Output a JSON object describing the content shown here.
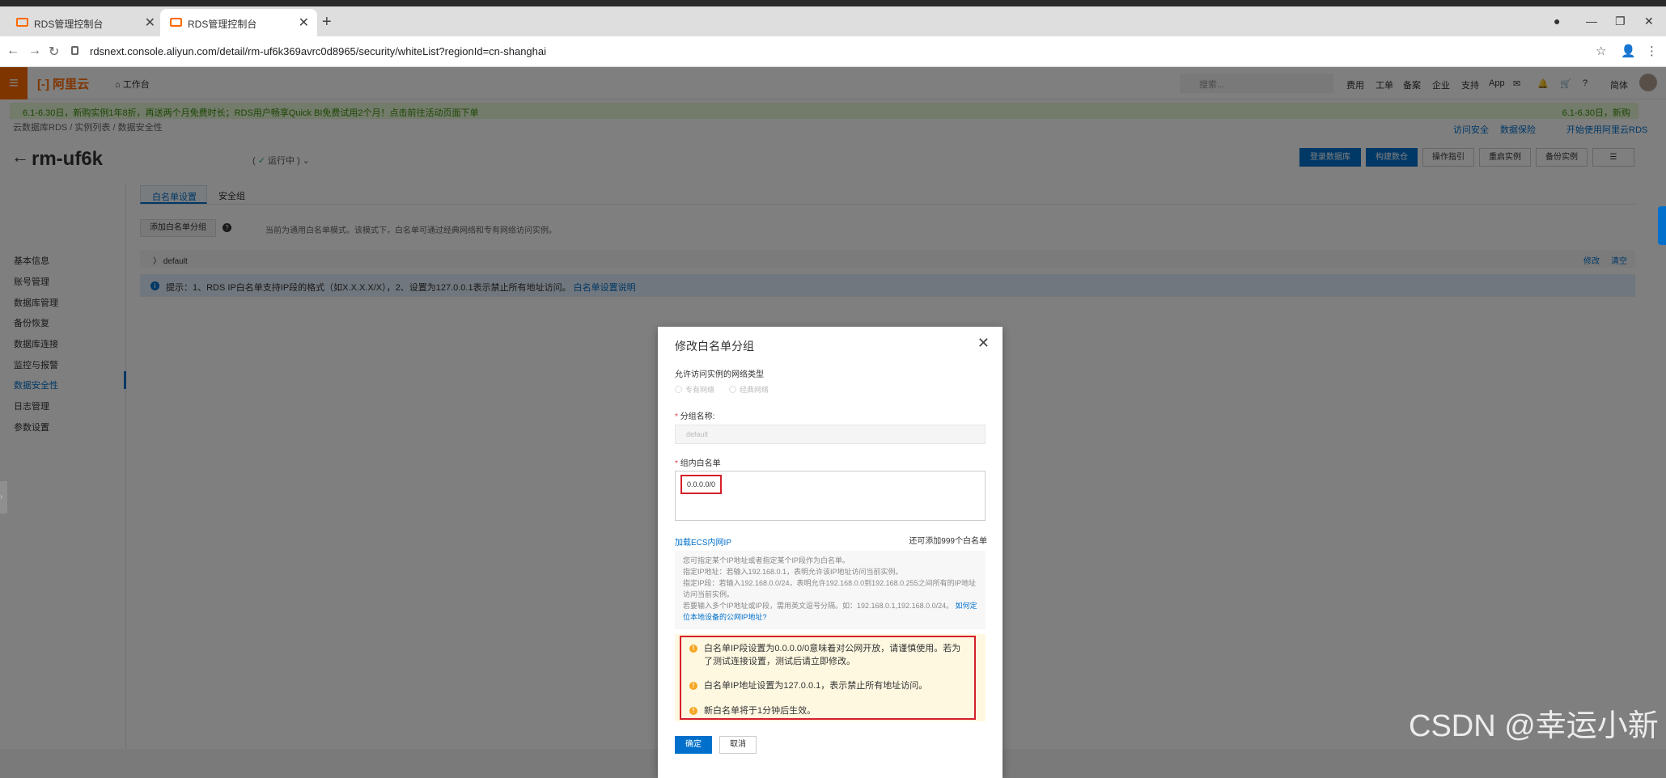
{
  "browser": {
    "tabs": [
      {
        "label": "RDS管理控制台"
      },
      {
        "label": "RDS管理控制台"
      }
    ],
    "url": "rdsnext.console.aliyun.com/detail/rm-uf6k369avrc0d8965/security/whiteList?regionId=cn-shanghai"
  },
  "app": {
    "logo": "阿里云",
    "workbench": "工作台",
    "search_placeholder": "搜索...",
    "topnav": [
      "费用",
      "工单",
      "备案",
      "企业",
      "支持",
      "App",
      "简体"
    ],
    "banner": "6.1-6.30日，新购实例1年8折，再送两个月免费时长；RDS用户畅享Quick BI免费试用2个月！点击前往活动页面下单",
    "banner_right": "6.1-6.30日，新购",
    "breadcrumb": [
      "云数据库RDS",
      "实例列表",
      "数据安全性"
    ],
    "top_links": [
      "访问安全",
      "数据保险",
      "开始使用阿里云RDS"
    ]
  },
  "instance": {
    "title": "rm-uf6k",
    "status": "运行中"
  },
  "header_buttons": [
    {
      "label": "登录数据库",
      "primary": true
    },
    {
      "label": "构建数仓",
      "primary": true
    },
    {
      "label": "操作指引",
      "primary": false
    },
    {
      "label": "重启实例",
      "primary": false
    },
    {
      "label": "备份实例",
      "primary": false
    }
  ],
  "sidebar": {
    "items": [
      {
        "label": "基本信息"
      },
      {
        "label": "账号管理"
      },
      {
        "label": "数据库管理"
      },
      {
        "label": "备份恢复"
      },
      {
        "label": "数据库连接"
      },
      {
        "label": "监控与报警"
      },
      {
        "label": "数据安全性",
        "active": true
      },
      {
        "label": "日志管理"
      },
      {
        "label": "参数设置"
      }
    ]
  },
  "content": {
    "tabs": [
      "白名单设置",
      "安全组"
    ],
    "add_group": "添加白名单分组",
    "mode_hint": "当前为通用白名单模式。该模式下，白名单可通过经典网络和专有网络访问实例。",
    "group_name": "default",
    "group_actions": [
      "修改",
      "清空"
    ],
    "tip": "提示：1、RDS IP白名单支持IP段的格式（如X.X.X.X/X），2、设置为127.0.0.1表示禁止所有地址访问。",
    "tip_link": "白名单设置说明"
  },
  "modal": {
    "title": "修改白名单分组",
    "network_label": "允许访问实例的网络类型",
    "network_options": [
      "专有网络",
      "经典网络"
    ],
    "group_label": "分组名称:",
    "group_value": "default",
    "whitelist_label": "组内白名单",
    "whitelist_value": "0.0.0.0/0",
    "ecs_link": "加载ECS内网IP",
    "remaining": "还可添加999个白名单",
    "help": [
      "您可指定某个IP地址或者指定某个IP段作为白名单。",
      "指定IP地址：若输入192.168.0.1，表明允许该IP地址访问当前实例。",
      "指定IP段：若输入192.168.0.0/24，表明允许192.168.0.0到192.168.0.255之间所有的IP地址访问当前实例。",
      "若要输入多个IP地址或IP段，需用英文逗号分隔。如：192.168.0.1,192.168.0.0/24。"
    ],
    "help_link": "如何定位本地设备的公网IP地址?",
    "warnings": [
      "白名单IP段设置为0.0.0.0/0意味着对公网开放，请谨慎使用。若为了测试连接设置，测试后请立即修改。",
      "白名单IP地址设置为127.0.0.1，表示禁止所有地址访问。",
      "新白名单将于1分钟后生效。"
    ],
    "ok": "确定",
    "cancel": "取消"
  },
  "watermark": "CSDN @幸运小新",
  "colors": {
    "brand": "#ff6a00",
    "primary": "#0070cc",
    "danger": "#d5202a",
    "warning": "#f5a623"
  }
}
